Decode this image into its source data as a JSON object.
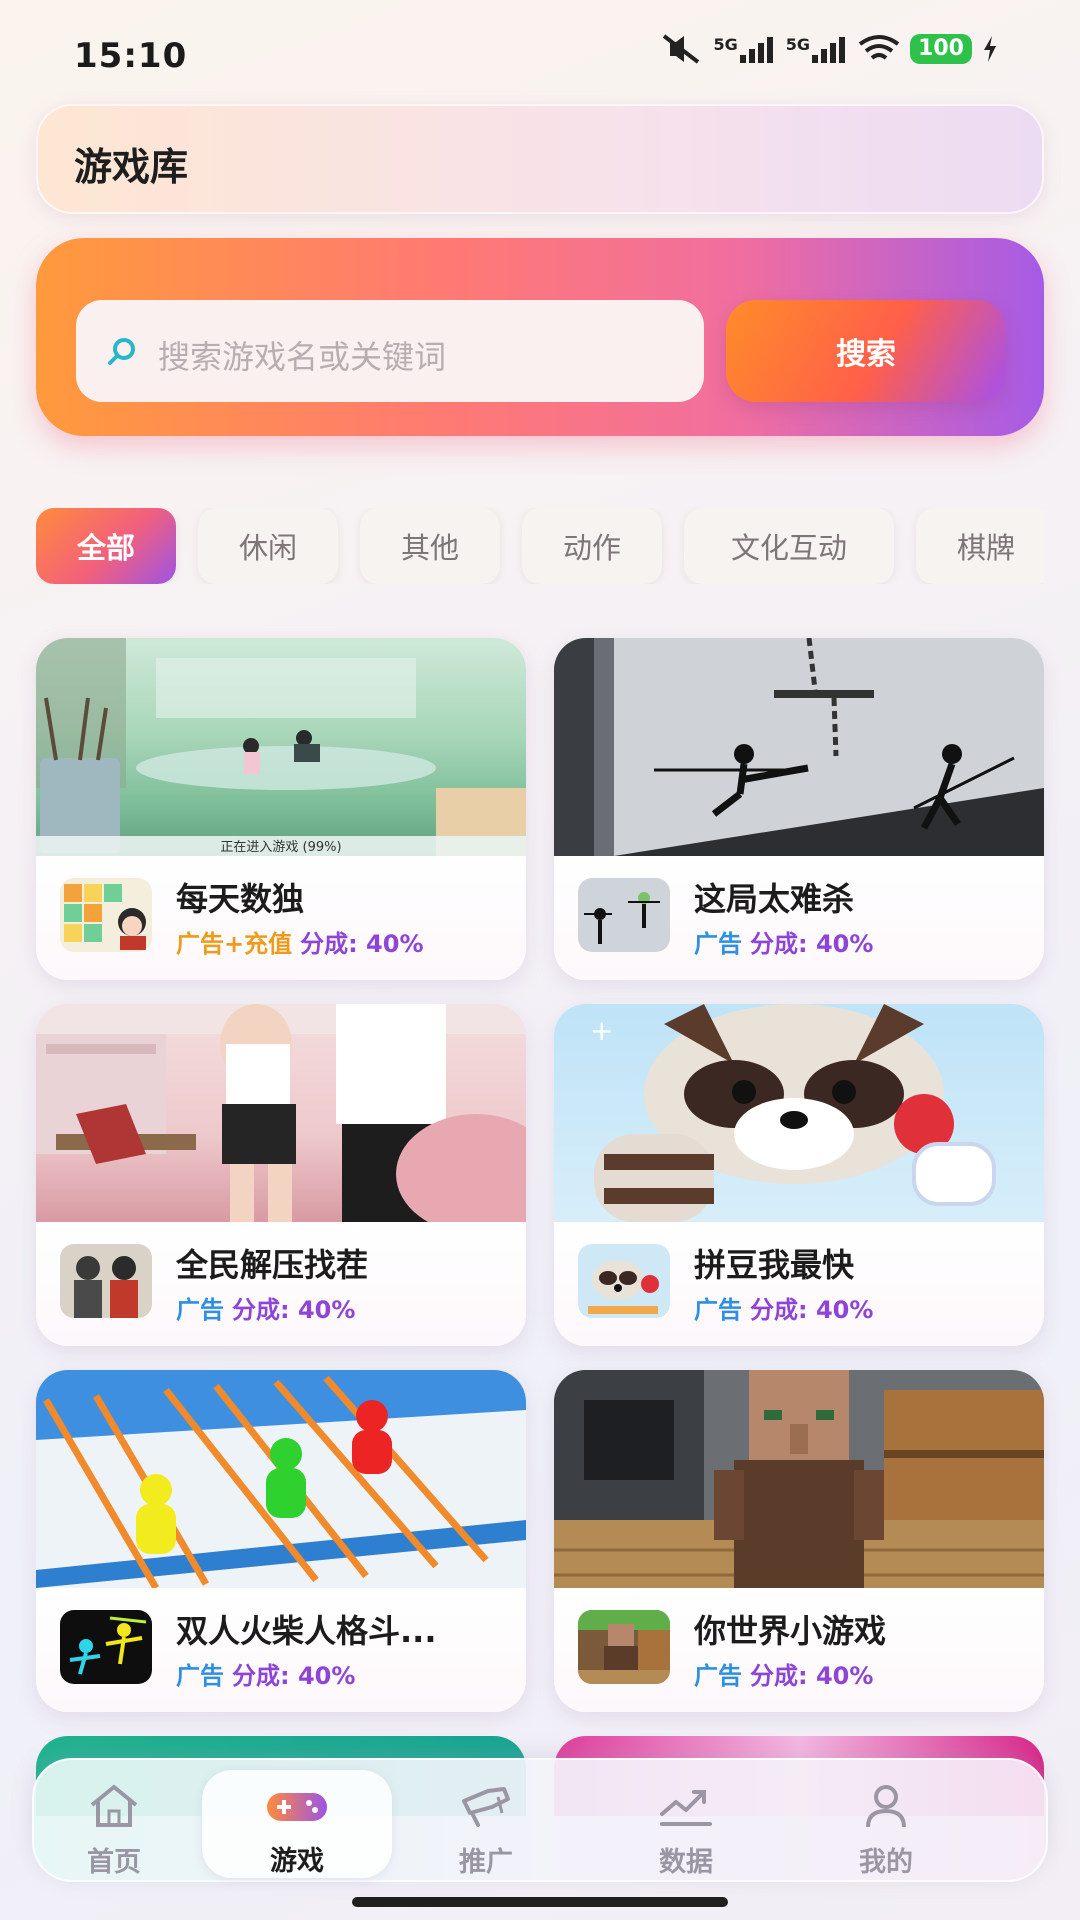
{
  "status_bar": {
    "time": "15:10",
    "battery": "100",
    "signal_1": "5G",
    "signal_2": "5G",
    "icons": [
      "mute-icon",
      "signal-icon",
      "signal-icon",
      "wifi-icon",
      "battery-icon",
      "charging-icon"
    ]
  },
  "header": {
    "title": "游戏库"
  },
  "search": {
    "placeholder": "搜索游戏名或关键词",
    "button_label": "搜索"
  },
  "categories": [
    {
      "label": "全部",
      "active": true
    },
    {
      "label": "休闲",
      "active": false
    },
    {
      "label": "其他",
      "active": false
    },
    {
      "label": "动作",
      "active": false
    },
    {
      "label": "文化互动",
      "active": false
    },
    {
      "label": "棋牌",
      "active": false
    }
  ],
  "games": [
    {
      "name": "每天数独",
      "monetization": "广告+充值",
      "share": "分成: 40%",
      "banner_caption": "正在进入游戏 (99%)"
    },
    {
      "name": "这局太难杀",
      "monetization": "广告",
      "share": "分成: 40%"
    },
    {
      "name": "全民解压找茬",
      "monetization": "广告",
      "share": "分成: 40%"
    },
    {
      "name": "拼豆我最快",
      "monetization": "广告",
      "share": "分成: 40%"
    },
    {
      "name": "双人火柴人格斗...",
      "monetization": "广告",
      "share": "分成: 40%"
    },
    {
      "name": "你世界小游戏",
      "monetization": "广告",
      "share": "分成: 40%"
    }
  ],
  "colors": {
    "accent_orange": "#ff8a3d",
    "accent_purple": "#9c54e6",
    "tag_blue": "#2f8fe3",
    "tag_orange": "#ee9b1c",
    "share_purple": "#8e44d6"
  },
  "bottom_nav": [
    {
      "label": "首页",
      "icon": "home-icon",
      "active": false
    },
    {
      "label": "游戏",
      "icon": "gamepad-icon",
      "active": true
    },
    {
      "label": "推广",
      "icon": "megaphone-icon",
      "active": false
    },
    {
      "label": "数据",
      "icon": "trend-chart-icon",
      "active": false
    },
    {
      "label": "我的",
      "icon": "user-icon",
      "active": false
    }
  ]
}
